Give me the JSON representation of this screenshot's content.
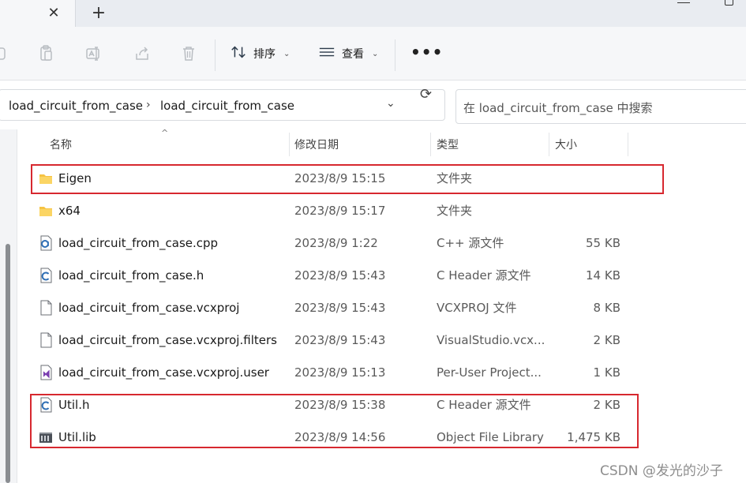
{
  "tabs": {
    "close_glyph": "✕",
    "new_tab_glyph": "+"
  },
  "commandbar": {
    "sort_label": "排序",
    "view_label": "查看",
    "more_glyph": "•••",
    "icons": [
      "copy-icon",
      "paste-icon",
      "rename-icon",
      "share-icon",
      "delete-icon"
    ]
  },
  "address": {
    "crumbs": [
      "load_circuit_from_case",
      "load_circuit_from_case"
    ],
    "separator": "›",
    "dropdown_glyph": "⌄",
    "refresh_glyph": "⟳"
  },
  "search": {
    "placeholder": "在 load_circuit_from_case 中搜索"
  },
  "columns": {
    "name": "名称",
    "date": "修改日期",
    "type": "类型",
    "size": "大小",
    "sort_glyph": "^"
  },
  "files": [
    {
      "name": "Eigen",
      "date": "2023/8/9 15:15",
      "type": "文件夹",
      "size": "",
      "icon": "folder-icon"
    },
    {
      "name": "x64",
      "date": "2023/8/9 15:17",
      "type": "文件夹",
      "size": "",
      "icon": "folder-icon"
    },
    {
      "name": "load_circuit_from_case.cpp",
      "date": "2023/8/9 1:22",
      "type": "C++ 源文件",
      "size": "55 KB",
      "icon": "cpp-file-icon"
    },
    {
      "name": "load_circuit_from_case.h",
      "date": "2023/8/9 15:43",
      "type": "C Header 源文件",
      "size": "14 KB",
      "icon": "c-header-file-icon"
    },
    {
      "name": "load_circuit_from_case.vcxproj",
      "date": "2023/8/9 15:43",
      "type": "VCXPROJ 文件",
      "size": "8 KB",
      "icon": "blank-file-icon"
    },
    {
      "name": "load_circuit_from_case.vcxproj.filters",
      "date": "2023/8/9 15:43",
      "type": "VisualStudio.vcx...",
      "size": "2 KB",
      "icon": "blank-file-icon"
    },
    {
      "name": "load_circuit_from_case.vcxproj.user",
      "date": "2023/8/9 15:13",
      "type": "Per-User Project...",
      "size": "1 KB",
      "icon": "visual-studio-file-icon"
    },
    {
      "name": "Util.h",
      "date": "2023/8/9 15:38",
      "type": "C Header 源文件",
      "size": "2 KB",
      "icon": "c-header-file-icon"
    },
    {
      "name": "Util.lib",
      "date": "2023/8/9 14:56",
      "type": "Object File Library",
      "size": "1,475 KB",
      "icon": "library-file-icon"
    }
  ],
  "watermark": "CSDN @发光的沙子",
  "colors": {
    "highlight": "#d7282f",
    "folder": "#f6c343",
    "c_badge": "#2f6fb5"
  }
}
